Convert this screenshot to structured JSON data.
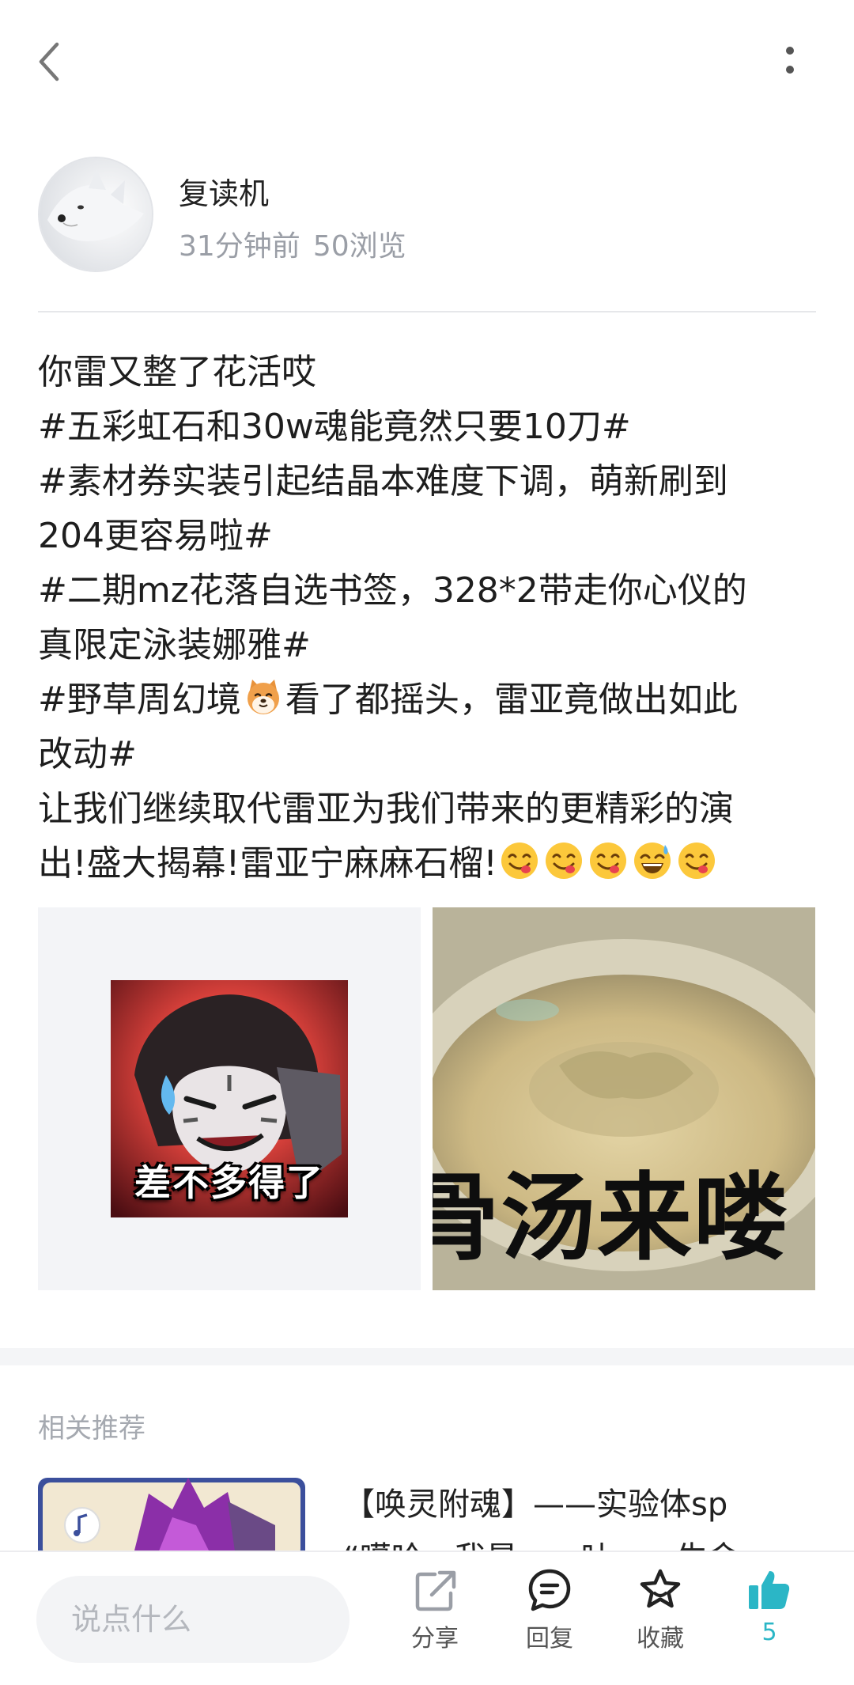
{
  "author": {
    "name": "复读机",
    "time": "31分钟前",
    "views": "50浏览"
  },
  "post": {
    "lines": [
      "你雷又整了花活哎",
      "#五彩虹石和30w魂能竟然只要10刀#",
      "#素材券实装引起结晶本难度下调，萌新刷到",
      "204更容易啦#",
      "#二期mz花落自选书签，328*2带走你心仪的",
      "真限定泳装娜雅#",
      "#野草周幻境",
      "看了都摇头，雷亚竟做出如此",
      "改动#",
      "让我们继续取代雷亚为我们带来的更精彩的演",
      "出!盛大揭幕!雷亚宁麻麻石榴!"
    ],
    "images": [
      {
        "caption": "差不多得了"
      },
      {
        "caption": "骨汤来喽"
      }
    ]
  },
  "recommend": {
    "title": "相关推荐",
    "items": [
      {
        "title": "【唤灵附魂】——实验体sp",
        "subtitle": "“噶哈，我是……吐……生命……"
      }
    ]
  },
  "bottom": {
    "placeholder": "说点什么",
    "share": "分享",
    "reply": "回复",
    "favorite": "收藏",
    "likes": "5"
  },
  "colors": {
    "accent": "#2bb6c6",
    "text": "#1e1e1e",
    "muted": "#9a9ea6"
  },
  "icons": {
    "back": "chevron-left-icon",
    "more": "more-vertical-icon",
    "share": "share-icon",
    "reply": "chat-bubble-icon",
    "favorite": "star-icon",
    "like": "thumbs-up-icon",
    "emoji": [
      "shiba-dog-icon",
      "yum-emoji-icon",
      "sweat-smile-emoji-icon"
    ]
  }
}
